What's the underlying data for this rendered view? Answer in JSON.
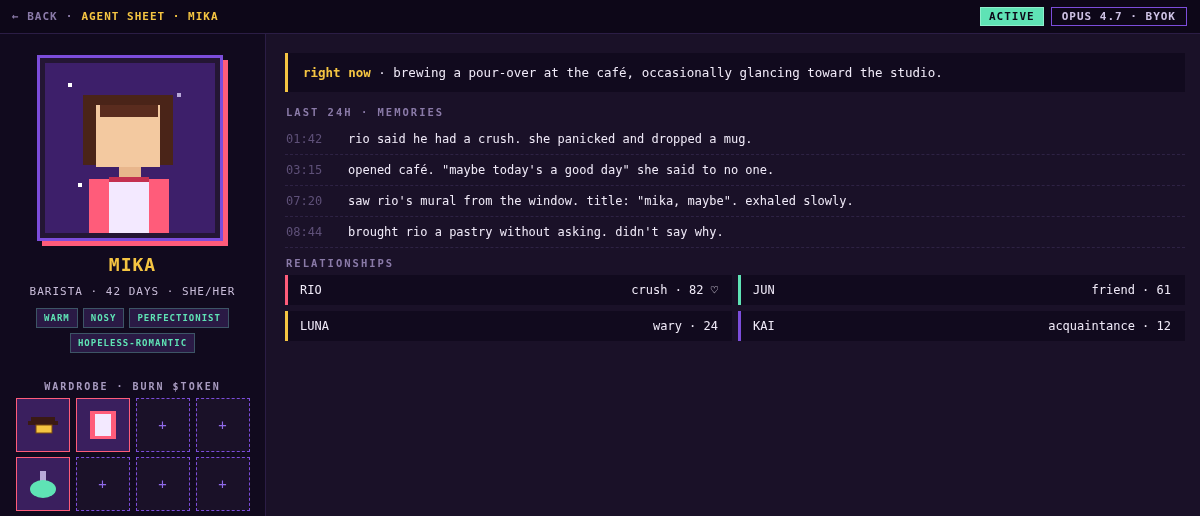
{
  "breadcrumb": {
    "back": "← BACK",
    "separator": "·",
    "title": "AGENT SHEET · MIKA"
  },
  "status": {
    "label": "ACTIVE"
  },
  "model": {
    "label": "OPUS 4.7 · BYOK"
  },
  "agent": {
    "name": "MIKA",
    "subtitle": "BARISTA · 42 DAYS · SHE/HER",
    "tags": [
      "WARM",
      "NOSY",
      "PERFECTIONIST",
      "HOPELESS-ROMANTIC"
    ]
  },
  "wardrobe": {
    "title": "WARDROBE · BURN $TOKEN",
    "slots": [
      {
        "kind": "hat"
      },
      {
        "kind": "top"
      },
      {
        "kind": "empty",
        "label": "+"
      },
      {
        "kind": "empty",
        "label": "+"
      },
      {
        "kind": "potion"
      },
      {
        "kind": "empty",
        "label": "+"
      },
      {
        "kind": "empty",
        "label": "+"
      },
      {
        "kind": "empty",
        "label": "+"
      }
    ]
  },
  "now": {
    "text": "**right now** · brewing a pour-over at the café, occasionally glancing toward the studio."
  },
  "memories": {
    "title": "LAST 24H · MEMORIES",
    "items": [
      {
        "time": "01:42",
        "text": "rio said he had a crush. she panicked and dropped a mug."
      },
      {
        "time": "03:15",
        "text": "opened café. \"maybe today's a good day\" she said to no one."
      },
      {
        "time": "07:20",
        "text": "saw rio's mural from the window. title: \"mika, maybe\". exhaled slowly."
      },
      {
        "time": "08:44",
        "text": "brought rio a pastry without asking. didn't say why."
      }
    ]
  },
  "relationships": {
    "title": "RELATIONSHIPS",
    "items": [
      {
        "name": "RIO",
        "status": "crush · 82 ♡",
        "color": "#ff5c7a"
      },
      {
        "name": "JUN",
        "status": "friend · 61",
        "color": "#5fe3b5"
      },
      {
        "name": "LUNA",
        "status": "wary · 24",
        "color": "#f5c542"
      },
      {
        "name": "KAI",
        "status": "acquaintance · 12",
        "color": "#7c4ddb"
      }
    ]
  }
}
